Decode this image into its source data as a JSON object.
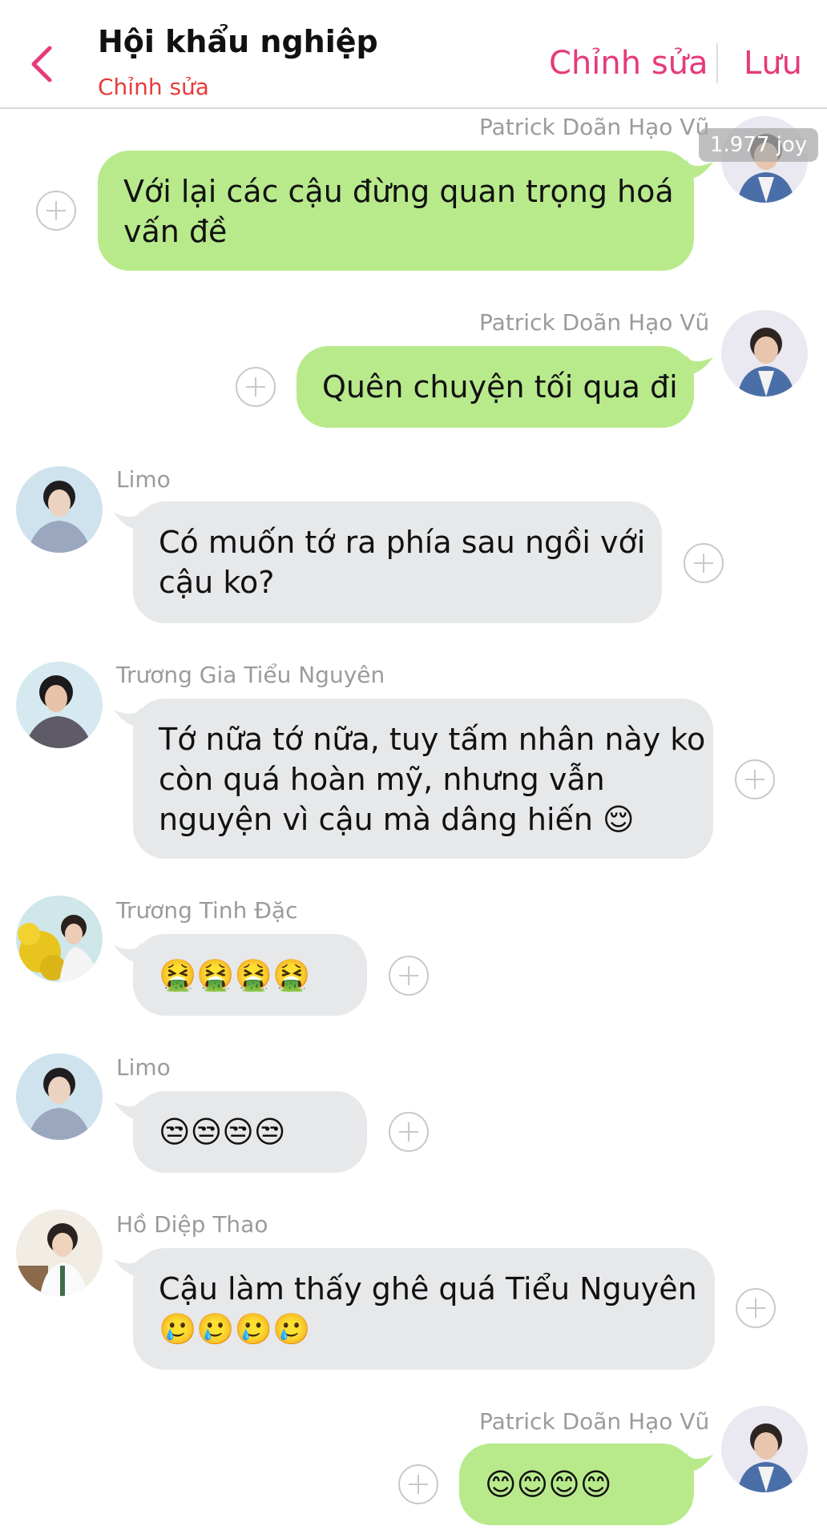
{
  "header": {
    "title": "Hội khẩu nghiệp",
    "subtitle": "Chỉnh sửa",
    "edit_label": "Chỉnh sửa",
    "save_label": "Lưu"
  },
  "overlay": {
    "joy_badge": "1.977 joy"
  },
  "messages": [
    {
      "sender": "Patrick Doãn Hạo Vũ",
      "lines": [
        "Với lại các cậu đừng quan trọng hoá",
        "vấn đề"
      ],
      "side": "right"
    },
    {
      "sender": "Patrick Doãn Hạo Vũ",
      "lines": [
        "Quên chuyện tối qua đi"
      ],
      "side": "right"
    },
    {
      "sender": "Limo",
      "lines": [
        "Có muốn tớ ra phía sau ngồi với",
        "cậu ko?"
      ],
      "side": "left"
    },
    {
      "sender": "Trương Gia Tiểu Nguyên",
      "lines": [
        "Tớ nữa tớ nữa, tuy tấm nhân này ko",
        "còn quá hoàn mỹ, nhưng vẫn",
        "nguyện vì cậu mà dâng hiến 😌"
      ],
      "side": "left"
    },
    {
      "sender": "Trương Tinh Đặc",
      "lines": [
        "🤮🤮🤮🤮"
      ],
      "side": "left"
    },
    {
      "sender": "Limo",
      "lines": [
        "😒😒😒😒"
      ],
      "side": "left"
    },
    {
      "sender": "Hồ Diệp Thao",
      "lines": [
        "Cậu làm thấy ghê quá Tiểu Nguyên",
        "🥲🥲🥲🥲"
      ],
      "side": "left"
    },
    {
      "sender": "Patrick Doãn Hạo Vũ",
      "lines": [
        "😊😊😊😊"
      ],
      "side": "right"
    }
  ],
  "colors": {
    "accent_pink": "#e63a7a",
    "subtitle_red": "#e53b3b",
    "bubble_green": "#b8ea8c",
    "bubble_gray": "#e6e8ea"
  },
  "icons": {
    "back": "chevron-left-icon",
    "add": "plus-circle-icon"
  }
}
